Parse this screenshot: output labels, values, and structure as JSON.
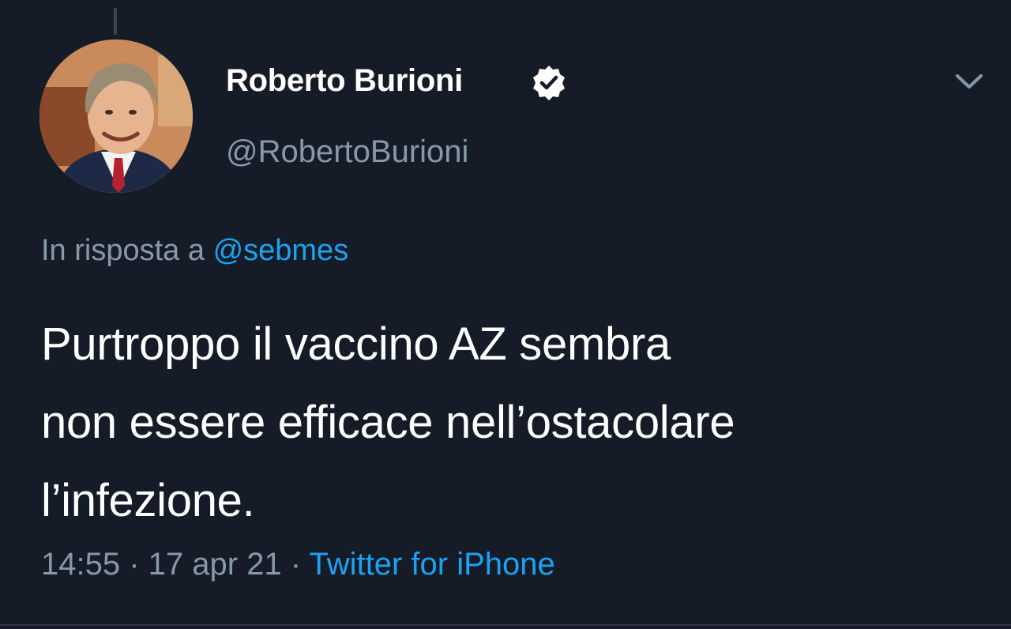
{
  "tweet": {
    "display_name": "Roberto Burioni",
    "verified": true,
    "handle": "@RobertoBurioni",
    "reply_prefix": "In risposta a ",
    "reply_to": "@sebmes",
    "text_lines": [
      "Purtroppo il vaccino AZ sembra",
      "non essere efficace nell’ostacolare",
      "l’infezione."
    ],
    "time": "14:55",
    "separator": " · ",
    "date": "17 apr 21",
    "source": "Twitter for iPhone"
  },
  "icons": {
    "verified": "verified-badge-icon",
    "more": "chevron-down-icon"
  },
  "colors": {
    "background": "#151c28",
    "text_primary": "#ffffff",
    "text_secondary": "#8899a6",
    "accent": "#1da1f2"
  }
}
